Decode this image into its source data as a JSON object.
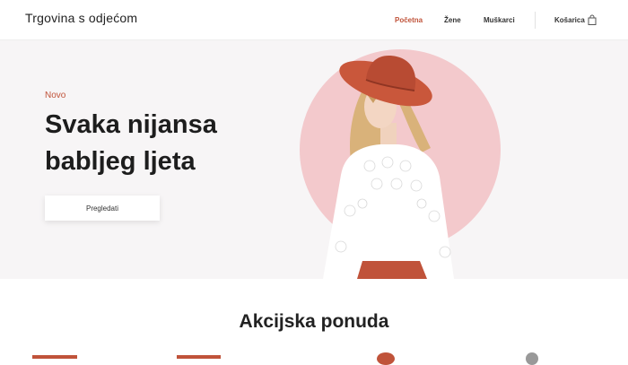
{
  "header": {
    "logo": "Trgovina s odjećom",
    "nav": [
      "Početna",
      "Žene",
      "Muškarci"
    ],
    "active_nav": "Početna",
    "cart_label": "Košarica",
    "cart_icon": "shopping-bag-icon"
  },
  "hero": {
    "tag": "Novo",
    "title_line1": "Svaka nijansa",
    "title_line2": "babljeg ljeta",
    "button_label": "Pregledati"
  },
  "section": {
    "title": "Akcijska ponuda"
  },
  "colors": {
    "accent": "#c0533a",
    "hero_bg": "#f7f5f6",
    "circle": "#f3c9cc",
    "text": "#222222"
  }
}
